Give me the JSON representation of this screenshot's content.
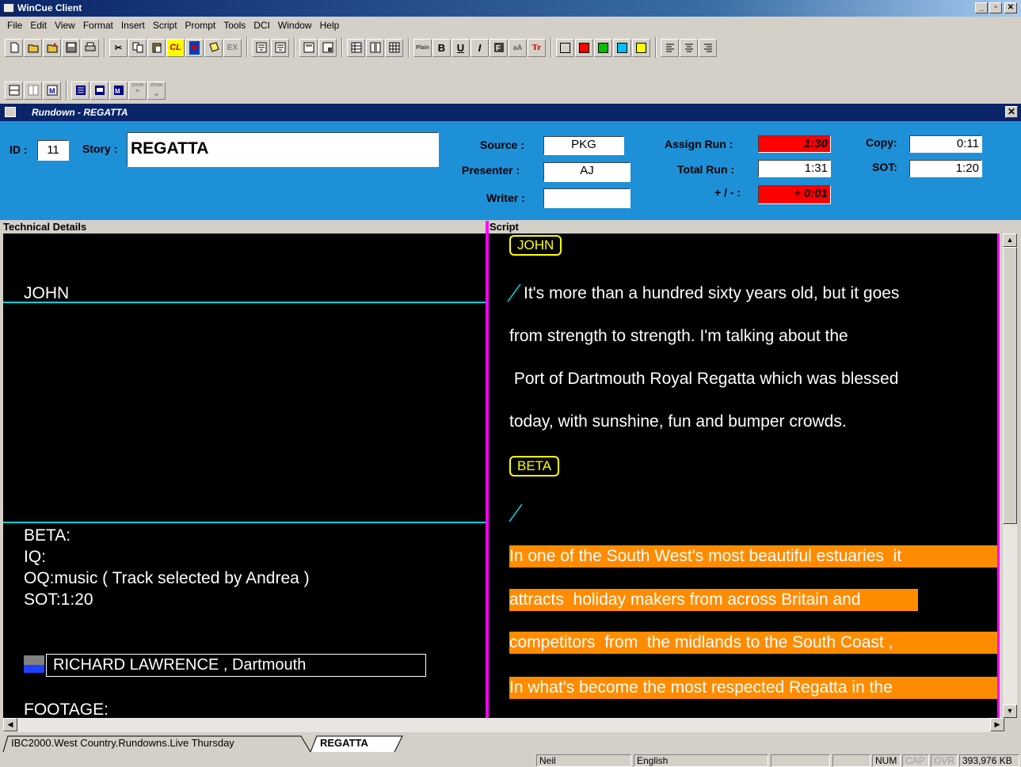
{
  "app": {
    "title": "WinCue Client"
  },
  "menu": [
    "File",
    "Edit",
    "View",
    "Format",
    "Insert",
    "Script",
    "Prompt",
    "Tools",
    "DCI",
    "Window",
    "Help"
  ],
  "toolbar": {
    "cl_label": "CL",
    "ex_label": "EX",
    "plain_label": "Plain",
    "bold_label": "B",
    "underline_label": "U",
    "italic_label": "I",
    "aa_label": "aA",
    "tt_label": "Tr",
    "zoom_label": "ZOOM",
    "colors": [
      "#ffffff",
      "#ff0000",
      "#00c000",
      "#00c0ff",
      "#ffff00"
    ]
  },
  "rundown": {
    "window_title": "Rundown - REGATTA",
    "id_label": "ID :",
    "id_value": "11",
    "story_label": "Story :",
    "story_value": "REGATTA",
    "source_label": "Source :",
    "source_value": "PKG",
    "presenter_label": "Presenter :",
    "presenter_value": "AJ",
    "writer_label": "Writer :",
    "writer_value": "",
    "assign_run_label": "Assign Run :",
    "assign_run_value": "1:30",
    "total_run_label": "Total Run :",
    "total_run_value": "1:31",
    "diff_label": "+ / - :",
    "diff_value": "+ 0:01",
    "copy_label": "Copy:",
    "copy_value": "0:11",
    "sot_label": "SOT:",
    "sot_value": "1:20"
  },
  "technical": {
    "header": "Technical Details",
    "presenter_cue": "JOHN",
    "beta_lines": [
      "BETA:",
      "IQ:",
      "OQ:music  ( Track selected by Andrea )",
      "SOT:1:20"
    ],
    "caption": "RICHARD LAWRENCE , Dartmouth",
    "footage": "FOOTAGE:"
  },
  "script": {
    "header": "Script",
    "tag_john": "JOHN",
    "lines_white": [
      "It's more than a hundred sixty years old, but it goes",
      "from strength to strength. I'm talking about the",
      " Port of Dartmouth Royal Regatta which was blessed",
      "today, with sunshine, fun and bumper crowds."
    ],
    "tag_beta": "BETA",
    "lines_orange": [
      "In one of the South West's most beautiful estuaries  it",
      "attracts  holiday makers from across Britain and",
      "competitors  from  the midlands to the South Coast ,",
      "In what's become the most respected Regatta in the"
    ]
  },
  "tabs": [
    "IBC2000.West Country.Rundowns.Live Thursday",
    "REGATTA"
  ],
  "status": {
    "user": "Neil",
    "language": "English",
    "num": "NUM",
    "cap": "CAP",
    "ovr": "OVR",
    "memory": "393,976 KB"
  }
}
